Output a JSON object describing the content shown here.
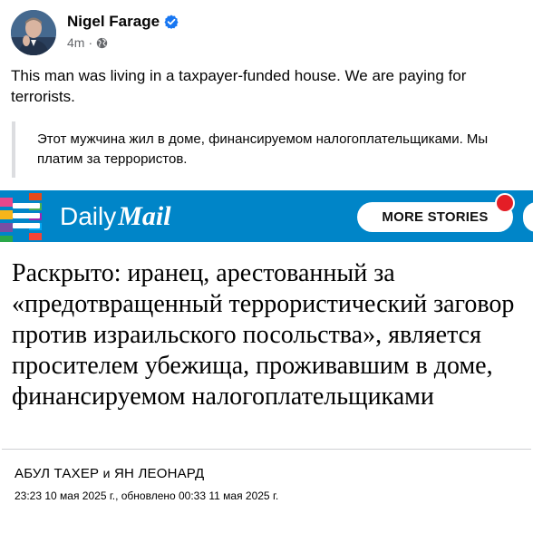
{
  "post": {
    "author": "Nigel Farage",
    "verified_icon": "verified-badge-icon",
    "time": "4m",
    "separator": "·",
    "audience_icon": "globe-icon",
    "text": "This man was living in a taxpayer-funded house. We are paying for terrorists.",
    "translation": "Этот мужчина жил в доме, финансируемом налогоплательщиками. Мы платим за террористов."
  },
  "article": {
    "brand_daily": "Daily",
    "brand_mail": "Mail",
    "more_stories": "MORE STORIES",
    "headline": "Раскрыто: иранец, арестованный за «предотвращенный террористический заговор против израильского посольства», является просителем убежища, проживавшим в доме, финансируемом налогоплательщиками",
    "author1": "АБУЛ ТАХЕР",
    "author_conj": "и",
    "author2": "ЯН ЛЕОНАРД",
    "timestamp": "23:23 10 мая 2025 г., обновлено 00:33 11 мая 2025 г."
  },
  "colors": {
    "dailymail_blue": "#0085c8",
    "verified_blue": "#1877f2",
    "notification_red": "#e41e26"
  }
}
